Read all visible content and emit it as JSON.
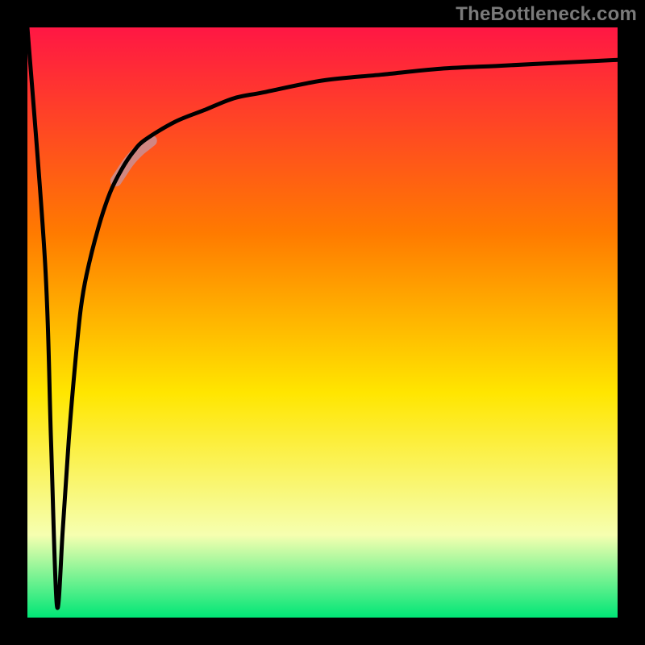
{
  "watermark": "TheBottleneck.com",
  "colors": {
    "frame": "#000000",
    "gradient_top": "#ff1744",
    "gradient_mid_upper": "#ff7b00",
    "gradient_mid": "#ffe600",
    "gradient_lower": "#f6ffb0",
    "gradient_bottom": "#00e676",
    "curve": "#000000",
    "highlight": "#c98f95"
  },
  "chart_data": {
    "type": "line",
    "title": "",
    "xlabel": "",
    "ylabel": "",
    "xlim": [
      0,
      100
    ],
    "ylim": [
      0,
      100
    ],
    "grid": false,
    "legend": false,
    "annotations": [
      "TheBottleneck.com"
    ],
    "series": [
      {
        "name": "bottleneck-curve",
        "comment": "y values estimated from the plotted curve; 0 = bottom (green), 100 = top (red). Sharp dip near x≈5 to y≈0, then rapid asymptotic rise toward y≈95.",
        "x": [
          0,
          3,
          4,
          5,
          6,
          7,
          8,
          9,
          10,
          12,
          14,
          16,
          18,
          20,
          25,
          30,
          35,
          40,
          50,
          60,
          70,
          80,
          90,
          100
        ],
        "y": [
          100,
          60,
          30,
          2,
          15,
          30,
          42,
          52,
          58,
          66,
          72,
          76,
          79,
          81,
          84,
          86,
          88,
          89,
          91,
          92,
          93,
          93.5,
          94,
          94.5
        ]
      },
      {
        "name": "highlight-segment",
        "comment": "Short thicker pale segment on the rising limb, roughly x 15–20.",
        "x": [
          15,
          16,
          17,
          18,
          19,
          20,
          21
        ],
        "y": [
          74,
          75.5,
          77,
          78.2,
          79.2,
          80,
          80.8
        ]
      }
    ]
  },
  "layout": {
    "outer_size": 800,
    "frame_thickness": 34,
    "inner_origin": 34,
    "inner_size": 732
  }
}
